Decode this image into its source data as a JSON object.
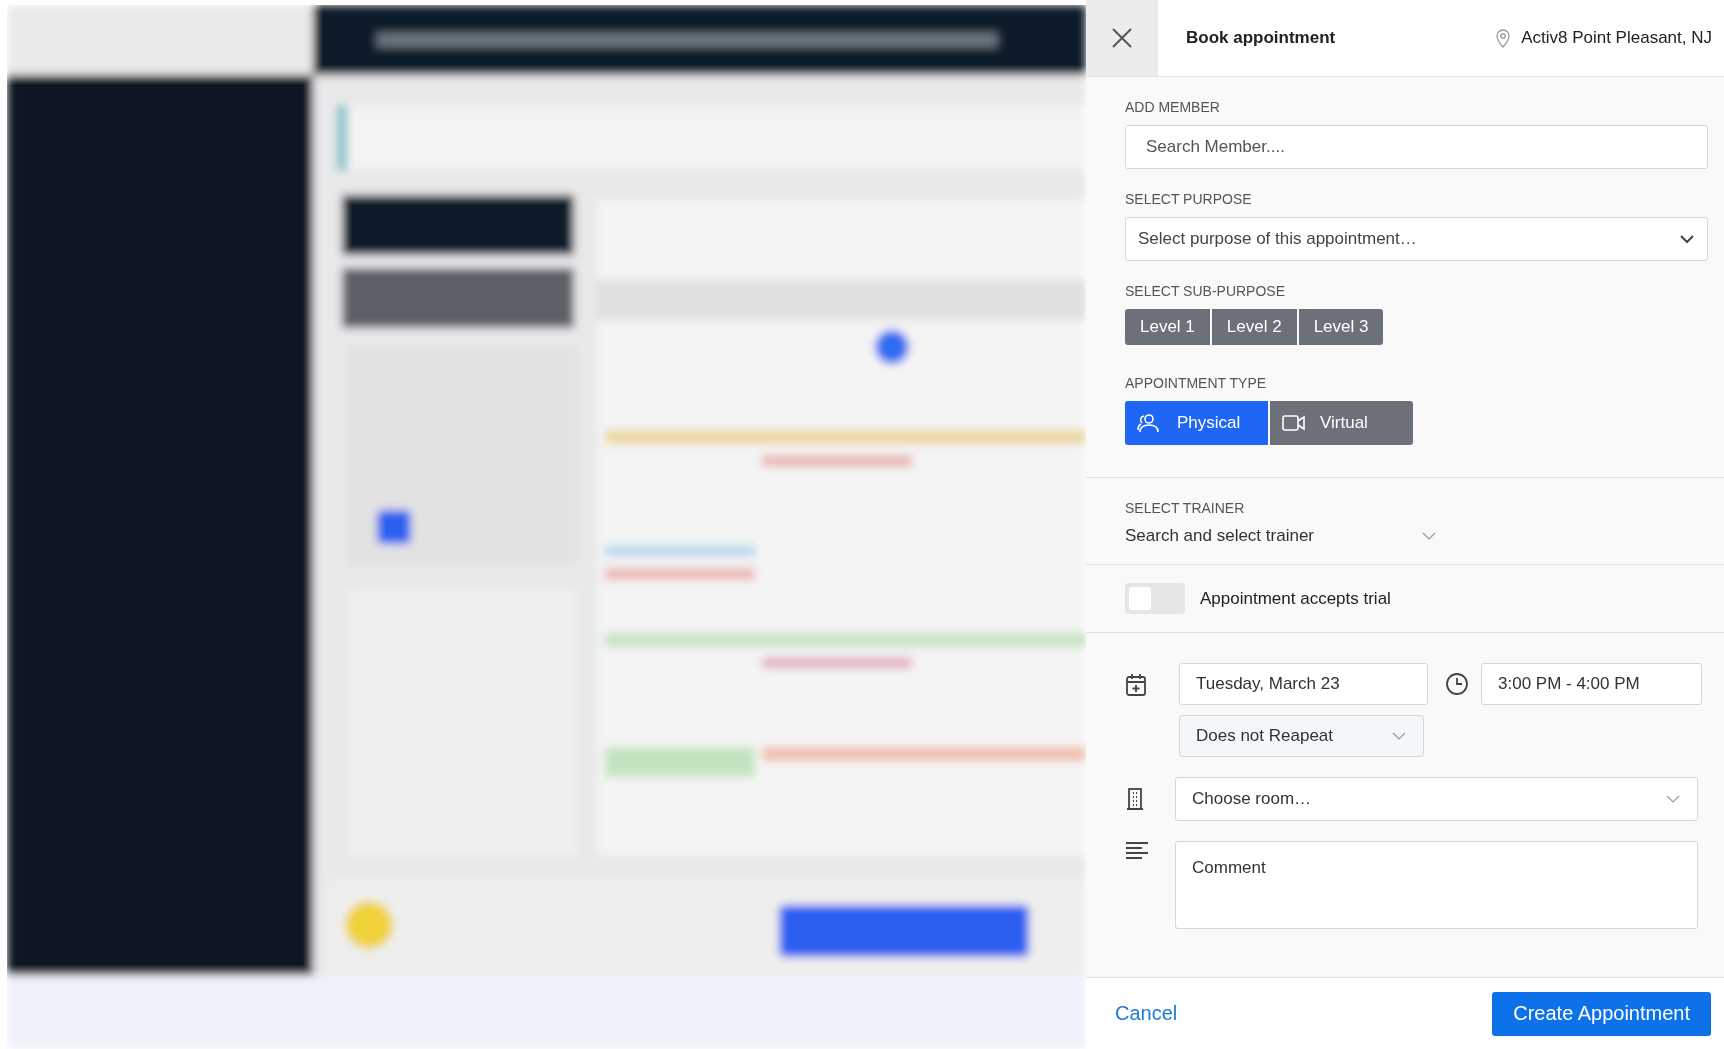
{
  "panel": {
    "title": "Book appointment",
    "location": "Activ8 Point Pleasant, NJ"
  },
  "member": {
    "label": "ADD MEMBER",
    "placeholder": "Search Member...."
  },
  "purpose": {
    "label": "SELECT PURPOSE",
    "placeholder": "Select purpose of this appointment…"
  },
  "sub_purpose": {
    "label": "SELECT SUB-PURPOSE",
    "options": [
      {
        "label": "Level 1",
        "selected": false
      },
      {
        "label": "Level 2",
        "selected": false
      },
      {
        "label": "Level 3",
        "selected": false
      }
    ]
  },
  "appointment_type": {
    "label": "APPOINTMENT TYPE",
    "options": [
      {
        "label": "Physical",
        "kind": "people",
        "selected": true
      },
      {
        "label": "Virtual",
        "kind": "video",
        "selected": false
      }
    ]
  },
  "trainer": {
    "label": "SELECT TRAINER",
    "placeholder": "Search and select trainer"
  },
  "trial": {
    "label": "Appointment accepts trial",
    "on": false
  },
  "schedule": {
    "date": "Tuesday, March 23",
    "time": "3:00 PM - 4:00 PM",
    "repeat": "Does not Reapeat"
  },
  "room": {
    "placeholder": "Choose room…"
  },
  "comment": {
    "placeholder": "Comment"
  },
  "footer": {
    "cancel": "Cancel",
    "submit": "Create Appointment"
  }
}
